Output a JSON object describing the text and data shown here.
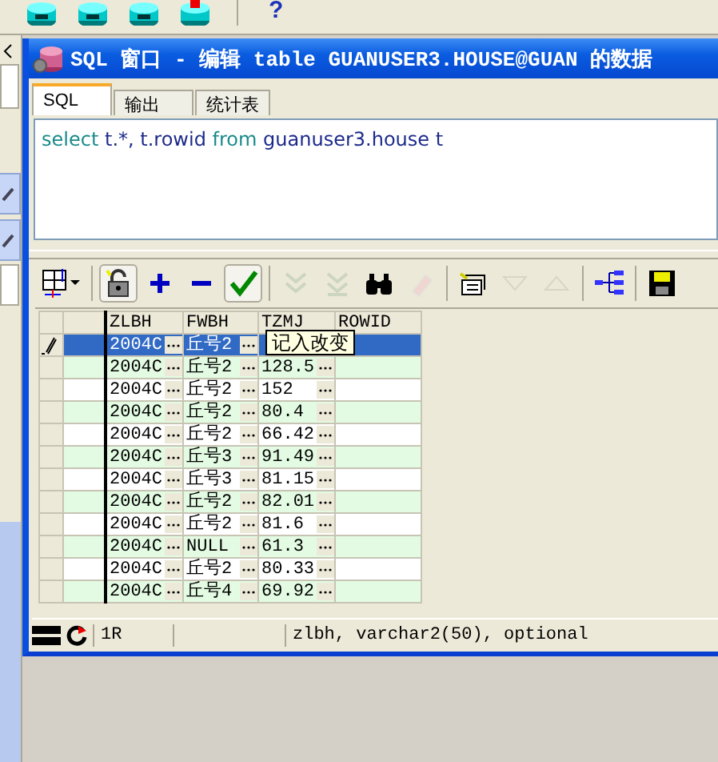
{
  "main_toolbar": {
    "buttons": [
      {
        "kind": "db"
      },
      {
        "kind": "db"
      },
      {
        "kind": "db"
      },
      {
        "kind": "db-alert"
      }
    ],
    "help": "?"
  },
  "window": {
    "title": "SQL 窗口 - 编辑 table GUANUSER3.HOUSE@GUAN 的数据"
  },
  "tabs": [
    {
      "label": "SQL",
      "selected": true
    },
    {
      "label": "输出",
      "selected": false
    },
    {
      "label": "统计表",
      "selected": false
    }
  ],
  "sql_editor": {
    "tokens": [
      {
        "text": "select",
        "kind": "keyword"
      },
      {
        "text": "t.*, t.rowid",
        "kind": "identifier"
      },
      {
        "text": "from",
        "kind": "keyword"
      },
      {
        "text": "guanuser3.house t",
        "kind": "identifier"
      }
    ]
  },
  "grid_toolbar": [
    {
      "kind": "grid",
      "disabled": false,
      "pressed": false
    },
    {
      "kind": "lock",
      "disabled": false,
      "pressed": true
    },
    {
      "kind": "add",
      "disabled": false,
      "pressed": false
    },
    {
      "kind": "remove",
      "disabled": false,
      "pressed": false
    },
    {
      "kind": "post",
      "disabled": false,
      "pressed": true
    },
    {
      "kind": "next",
      "disabled": true,
      "pressed": false
    },
    {
      "kind": "last",
      "disabled": true,
      "pressed": false
    },
    {
      "kind": "find",
      "disabled": false,
      "pressed": false
    },
    {
      "kind": "clear",
      "disabled": true,
      "pressed": false
    },
    {
      "kind": "export",
      "disabled": false,
      "pressed": false
    },
    {
      "kind": "down",
      "disabled": true,
      "pressed": false
    },
    {
      "kind": "up",
      "disabled": true,
      "pressed": false
    },
    {
      "kind": "tree",
      "disabled": false,
      "pressed": false
    },
    {
      "kind": "save",
      "disabled": false,
      "pressed": false
    }
  ],
  "table": {
    "columns": [
      "ZLBH",
      "FWBH",
      "TZMJ",
      "ROWID"
    ],
    "rows": [
      {
        "selected": true,
        "editing": true,
        "cells": [
          "2004C",
          "丘号2"
        ]
      },
      {
        "selected": false,
        "editing": false,
        "cells": [
          "2004C",
          "丘号2",
          "128.5"
        ]
      },
      {
        "selected": false,
        "editing": false,
        "cells": [
          "2004C",
          "丘号2",
          "152"
        ]
      },
      {
        "selected": false,
        "editing": false,
        "cells": [
          "2004C",
          "丘号2",
          "80.4"
        ]
      },
      {
        "selected": false,
        "editing": false,
        "cells": [
          "2004C",
          "丘号2",
          "66.42"
        ]
      },
      {
        "selected": false,
        "editing": false,
        "cells": [
          "2004C",
          "丘号3",
          "91.49"
        ]
      },
      {
        "selected": false,
        "editing": false,
        "cells": [
          "2004C",
          "丘号3",
          "81.15"
        ]
      },
      {
        "selected": false,
        "editing": false,
        "cells": [
          "2004C",
          "丘号2",
          "82.01"
        ]
      },
      {
        "selected": false,
        "editing": false,
        "cells": [
          "2004C",
          "丘号2",
          "81.6"
        ]
      },
      {
        "selected": false,
        "editing": false,
        "cells": [
          "2004C",
          "NULL",
          "61.3"
        ]
      },
      {
        "selected": false,
        "editing": false,
        "cells": [
          "2004C",
          "丘号2",
          "80.33"
        ]
      },
      {
        "selected": false,
        "editing": false,
        "cells": [
          "2004C",
          "丘号4",
          "69.92"
        ]
      }
    ]
  },
  "tooltip": "记入改变",
  "status_bar": {
    "record": "1R",
    "info": "zlbh, varchar2(50), optional"
  }
}
